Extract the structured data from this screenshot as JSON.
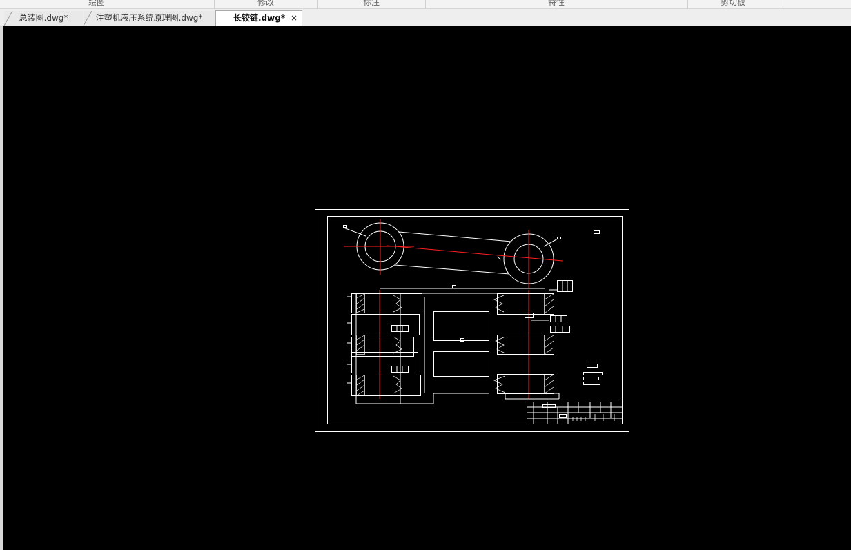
{
  "ribbon": {
    "panels": [
      {
        "label": "绘图"
      },
      {
        "label": "修改"
      },
      {
        "label": "标注"
      },
      {
        "label": "特性"
      },
      {
        "label": "剪切板"
      }
    ]
  },
  "tabs": [
    {
      "label": "总装图.dwg*",
      "active": false
    },
    {
      "label": "注塑机液压系统原理图.dwg*",
      "active": false
    },
    {
      "label": "长铰链.dwg*",
      "active": true,
      "close_glyph": "×"
    }
  ],
  "canvas": {
    "background": "#000000",
    "line_color": "#ffffff",
    "center_line_color": "#ff0000"
  }
}
